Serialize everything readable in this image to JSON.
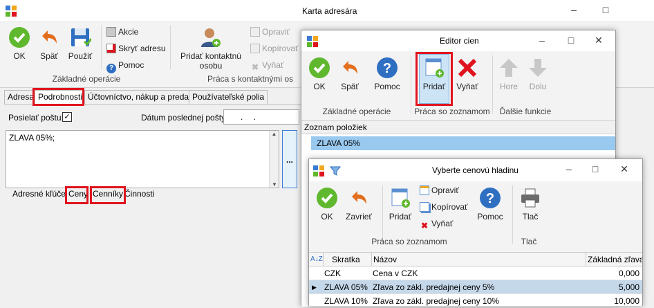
{
  "main": {
    "title": "Karta adresára",
    "toolbar": {
      "ok": "OK",
      "back": "Späť",
      "apply": "Použiť",
      "actions": "Akcie",
      "hide_address": "Skryť adresu",
      "help": "Pomoc",
      "add_contact_line1": "Pridať kontaktnú",
      "add_contact_line2": "osobu",
      "edit": "Opraviť",
      "copy": "Kopírovať",
      "remove": "Vyňať",
      "group_basic": "Základné operácie",
      "group_contacts": "Práca s kontaktnými os"
    },
    "tabs": [
      "Adresa",
      "Podrobnosti",
      "Účtovníctvo, nákup a predaj",
      "Používateľské polia"
    ],
    "send_mail_label": "Posielať poštu:",
    "last_mail_label": "Dátum poslednej pošty:",
    "last_mail_value": ". .",
    "note_text": "ZLAVA 05%;",
    "ellipsis": "...",
    "subtabs": [
      "Adresné kľúče",
      "Ceny",
      "Cenníky",
      "Činnosti"
    ]
  },
  "editor": {
    "title": "Editor cien",
    "toolbar": {
      "ok": "OK",
      "back": "Späť",
      "help": "Pomoc",
      "add": "Pridať",
      "remove": "Vyňať",
      "up": "Hore",
      "down": "Dolu",
      "group_basic": "Základné operácie",
      "group_list": "Práca so zoznamom",
      "group_more": "Ďalšie funkcie"
    },
    "list_header": "Zoznam položiek",
    "items": [
      "ZLAVA 05%"
    ]
  },
  "picker": {
    "title": "Vyberte cenovú hladinu",
    "toolbar": {
      "ok": "OK",
      "close": "Zavrieť",
      "add": "Pridať",
      "edit": "Opraviť",
      "copy": "Kopírovať",
      "remove": "Vyňať",
      "help": "Pomoc",
      "print": "Tlač",
      "group_list": "Práca so zoznamom",
      "group_print": "Tlač"
    },
    "columns": [
      "Skratka",
      "Názov",
      "Základná zľava"
    ],
    "rows": [
      {
        "code": "CZK",
        "name": "Cena v CZK",
        "discount": "0,000"
      },
      {
        "code": "ZLAVA 05%",
        "name": "Zľava zo zákl. predajnej ceny 5%",
        "discount": "5,000"
      },
      {
        "code": "ZLAVA 10%",
        "name": "Zľava zo zákl. predajnej ceny 10%",
        "discount": "10,000"
      }
    ]
  },
  "colors": {
    "accent_red": "#e0141e",
    "selection": "#99c9ef",
    "ok_green": "#5fb82d",
    "help_blue": "#2f6fc2"
  }
}
